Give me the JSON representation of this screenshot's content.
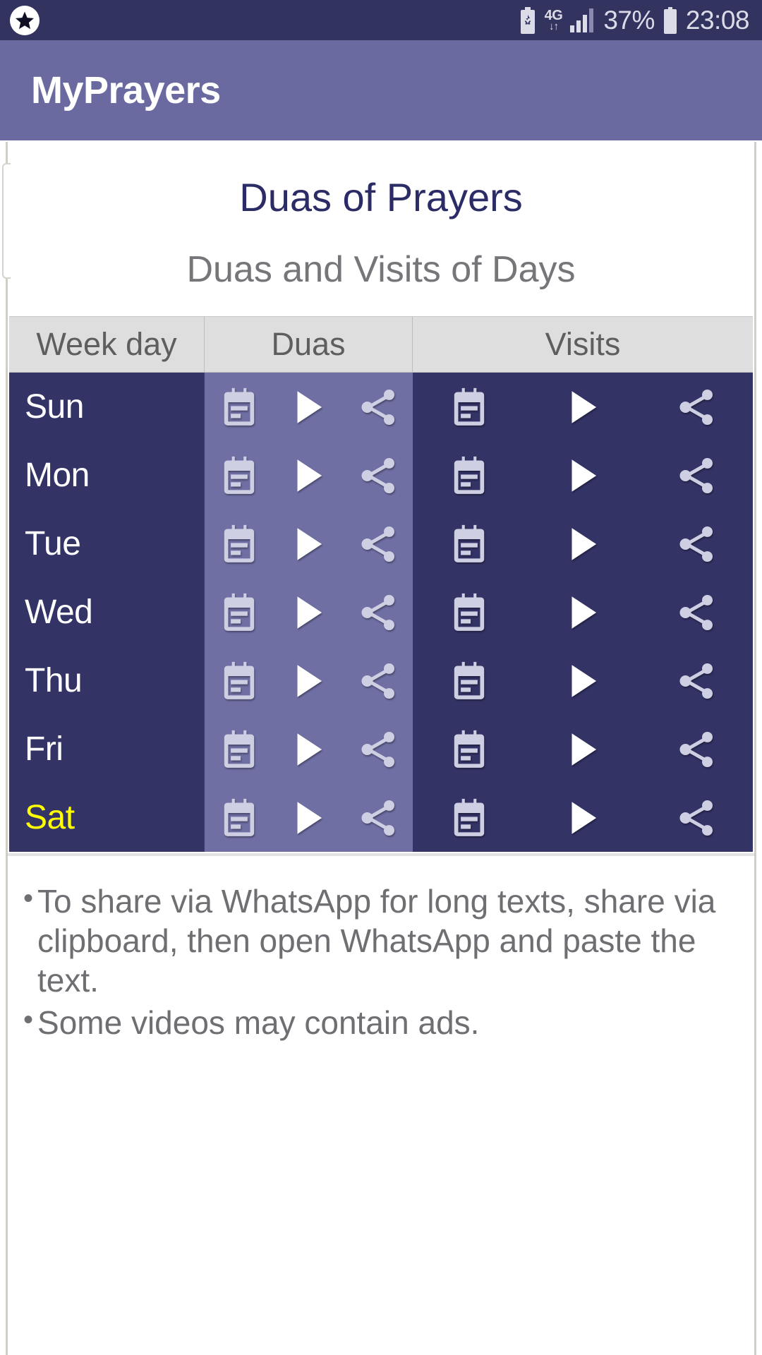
{
  "status_bar": {
    "left_icon": "star-badge-icon",
    "icons": [
      "battery-saver-icon",
      "mobile-data-4g-icon",
      "signal-bars-icon",
      "battery-icon"
    ],
    "network_label": "4G",
    "network_arrows": "↓↑",
    "battery_percent": "37%",
    "time": "23:08",
    "background_color": "#33335f",
    "text_color": "#dcdce8"
  },
  "app_bar": {
    "title": "MyPrayers",
    "background_color": "#6a6aa0",
    "title_color": "#ffffff"
  },
  "page": {
    "title": "Duas of Prayers",
    "subtitle": "Duas and Visits of Days",
    "title_color": "#2b2b66",
    "subtitle_color": "#76767a"
  },
  "table": {
    "headers": [
      "Week day",
      "Duas",
      "Visits"
    ],
    "header_background": "#dedede",
    "header_text_color": "#5e5e5e",
    "day_column_background": "#333366",
    "duas_column_background": "#6f6fa4",
    "visits_column_background": "#333366",
    "day_text_color": "#ffffff",
    "highlight_color": "#ffff00",
    "action_icons": [
      "text-note-icon",
      "play-icon",
      "share-icon"
    ],
    "rows": [
      {
        "day": "Sun",
        "highlighted": false
      },
      {
        "day": "Mon",
        "highlighted": false
      },
      {
        "day": "Tue",
        "highlighted": false
      },
      {
        "day": "Wed",
        "highlighted": false
      },
      {
        "day": "Thu",
        "highlighted": false
      },
      {
        "day": "Fri",
        "highlighted": false
      },
      {
        "day": "Sat",
        "highlighted": true
      }
    ]
  },
  "notes": {
    "bullet": "•",
    "items": [
      "To share via WhatsApp for long texts, share via clipboard, then open WhatsApp and paste the text.",
      "Some videos may contain ads."
    ],
    "text_color": "#6f6f73"
  }
}
